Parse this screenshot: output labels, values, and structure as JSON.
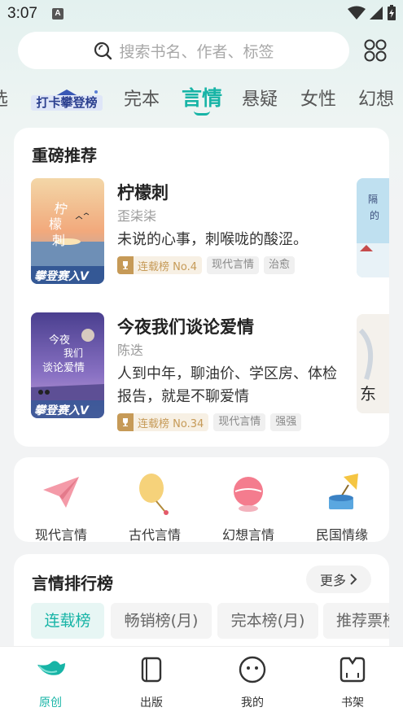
{
  "status_bar": {
    "time": "3:07",
    "app_badge": "A"
  },
  "search": {
    "placeholder": "搜索书名、作者、标签"
  },
  "category_tabs": [
    {
      "label": "选"
    },
    {
      "label": "打卡攀登榜"
    },
    {
      "label": "完本"
    },
    {
      "label": "言情"
    },
    {
      "label": "悬疑"
    },
    {
      "label": "女性"
    },
    {
      "label": "幻想"
    }
  ],
  "featured": {
    "title": "重磅推荐",
    "books": [
      {
        "title": "柠檬刺",
        "author": "歪柒柒",
        "desc": "未说的心事，刺喉咙的酸涩。",
        "rank": "连载榜 No.4",
        "tags": [
          "现代言情",
          "治愈"
        ],
        "cover_text": "柠檬刺",
        "cover_badge": "攀登赛入V"
      },
      {
        "title": "今夜我们谈论爱情",
        "author": "陈迭",
        "desc": "人到中年，聊油价、学区房、体检报告，就是不聊爱情",
        "rank": "连载榜 No.34",
        "tags": [
          "现代言情",
          "强强"
        ],
        "cover_text": "今夜我们谈论爱情",
        "cover_badge": "攀登赛入V"
      }
    ]
  },
  "genres": [
    {
      "label": "现代言情",
      "icon": "paper-plane-icon"
    },
    {
      "label": "古代言情",
      "icon": "fan-icon"
    },
    {
      "label": "幻想言情",
      "icon": "crystal-ball-icon"
    },
    {
      "label": "民国情缘",
      "icon": "gramophone-icon"
    }
  ],
  "ranking": {
    "title": "言情排行榜",
    "more": "更多",
    "tabs": [
      "连载榜",
      "畅销榜(月)",
      "完本榜(月)",
      "推荐票榜"
    ]
  },
  "bottom_nav": [
    {
      "label": "原创",
      "icon": "bird-icon"
    },
    {
      "label": "出版",
      "icon": "book-icon"
    },
    {
      "label": "我的",
      "icon": "smiley-icon"
    },
    {
      "label": "书架",
      "icon": "bookshelf-icon"
    }
  ],
  "colors": {
    "accent": "#17b4a6",
    "rank_gold": "#c69a57"
  }
}
